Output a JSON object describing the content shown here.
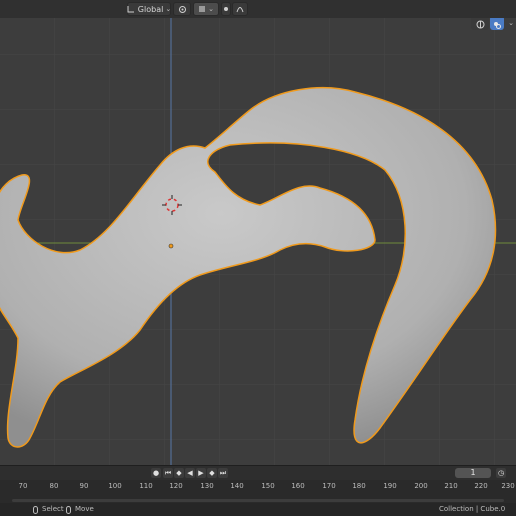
{
  "header": {
    "transform_orientation": "Global",
    "pivot_icon": "pivot-point-icon",
    "snap_icon": "snap-magnet-icon",
    "proportional_icon": "proportional-editing-icon",
    "falloff_icon": "falloff-curve-icon"
  },
  "viewport": {
    "object_outline_color": "#f09a1c",
    "mesh_color": "#b4b4b4",
    "x_axis_color": "#6f8c3c",
    "y_axis_color": "#5677a6",
    "overlay_icons": [
      "viewport-gizmo-icon",
      "overlay-icon"
    ]
  },
  "timeline": {
    "current_frame": "1",
    "ticks": [
      "70",
      "80",
      "90",
      "100",
      "110",
      "120",
      "130",
      "140",
      "150",
      "160",
      "170",
      "180",
      "190",
      "200",
      "210",
      "220",
      "230"
    ],
    "playback_icons": [
      "record-icon",
      "jump-start-icon",
      "prev-keyframe-icon",
      "play-reverse-icon",
      "play-icon",
      "next-keyframe-icon",
      "jump-end-icon"
    ]
  },
  "statusbar": {
    "select_label": "Select",
    "move_label": "Move",
    "collection_info": "Collection | Cube.0"
  }
}
